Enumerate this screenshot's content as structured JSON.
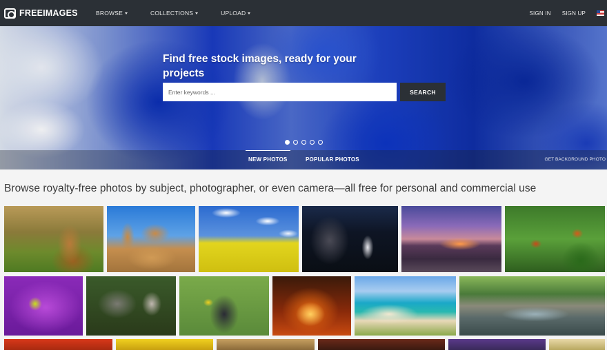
{
  "nav": {
    "logo_text": "FREEIMAGES",
    "menu": [
      {
        "label": "BROWSE"
      },
      {
        "label": "COLLECTIONS"
      },
      {
        "label": "UPLOAD"
      }
    ],
    "sign_in": "SIGN IN",
    "sign_up": "SIGN UP",
    "language_flag": "us-flag-icon"
  },
  "hero": {
    "title": "Find free stock images, ready for your projects",
    "search_placeholder": "Enter keywords ...",
    "search_button": "SEARCH",
    "slides_total": 5,
    "slide_active": 1,
    "tabs": [
      {
        "label": "NEW PHOTOS",
        "active": true
      },
      {
        "label": "POPULAR PHOTOS",
        "active": false
      }
    ],
    "get_background": "GET BACKGROUND PHOTO"
  },
  "content": {
    "tagline": "Browse royalty-free photos by subject, photographer, or even camera—all free for personal and commercial use"
  },
  "gallery": {
    "row1": [
      "horse",
      "desert-rocks",
      "rapeseed-field",
      "night-cemetery",
      "sunset",
      "butterfly"
    ],
    "row2": [
      "purple-flower",
      "cat",
      "bird",
      "fire",
      "beach",
      "river"
    ],
    "row3": [
      "red-flowers",
      "yellow-flower",
      "animal",
      "autumn-trees",
      "purple-sky",
      "field"
    ]
  },
  "colors": {
    "navbar": "#2b3036",
    "search_button": "#2b3036",
    "page_background": "#f4f4f4"
  }
}
